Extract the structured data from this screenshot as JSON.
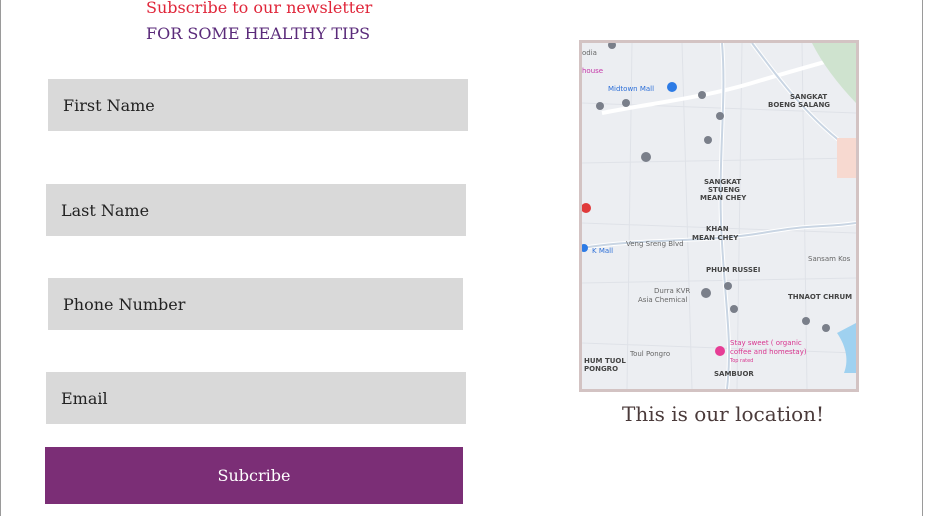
{
  "newsletter": {
    "title": "Subscribe to our newsletter",
    "subtitle": "FOR SOME HEALTHY TIPS"
  },
  "form": {
    "first_name_placeholder": "First Name",
    "last_name_placeholder": "Last Name",
    "phone_placeholder": "Phone Number",
    "email_placeholder": "Email",
    "submit_label": "Subcribe"
  },
  "location": {
    "caption": "This is our location!",
    "map_labels": {
      "midtown_mall": "Midtown Mall",
      "sangkat_boeng_salang": "SANGKAT",
      "boeng_salang": "BOENG SALANG",
      "sangkat_stueng": "SANGKAT",
      "stueng": "STUENG",
      "mean_chey": "MEAN CHEY",
      "khan": "KHAN",
      "khan_mean_chey": "MEAN CHEY",
      "phum_russei": "PHUM RUSSEI",
      "durra_kvr": "Durra KVR",
      "asia_chemical": "Asia Chemical",
      "thnaot_chrum": "THNAOT CHRUM",
      "stay_sweet_1": "Stay sweet ( organic",
      "stay_sweet_2": "coffee and homestay)",
      "top_rated": "Top rated",
      "hum_tuol": "HUM TUOL",
      "pongro": "PONGRO",
      "sambuor": "SAMBUOR",
      "sansam_kos": "Sansam Kos",
      "k_mall": "K Mall",
      "veng_sreng_blvd": "Veng Sreng Blvd",
      "toul_pongro": "Toul Pongro",
      "house": "house",
      "odia": "odia"
    }
  }
}
